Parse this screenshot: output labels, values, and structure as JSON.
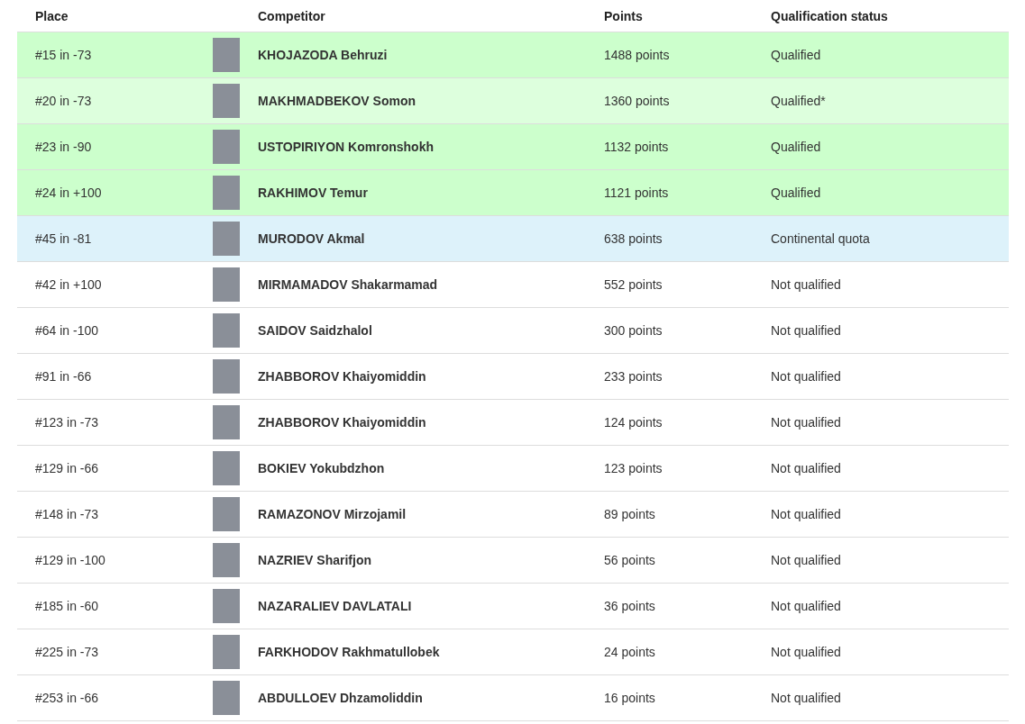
{
  "table": {
    "columns": [
      "Place",
      "Competitor",
      "Points",
      "Qualification status"
    ],
    "rows": [
      {
        "place": "#15 in -73",
        "competitor": "KHOJAZODA Behruzi",
        "points": "1488 points",
        "status": "Qualified",
        "color": "#ccffcc"
      },
      {
        "place": "#20 in -73",
        "competitor": "MAKHMADBEKOV Somon",
        "points": "1360 points",
        "status": "Qualified*",
        "color": "#ddffdd"
      },
      {
        "place": "#23 in -90",
        "competitor": "USTOPIRIYON Komronshokh",
        "points": "1132 points",
        "status": "Qualified",
        "color": "#ccffcc"
      },
      {
        "place": "#24 in +100",
        "competitor": "RAKHIMOV Temur",
        "points": "1121 points",
        "status": "Qualified",
        "color": "#ccffcc"
      },
      {
        "place": "#45 in -81",
        "competitor": "MURODOV Akmal",
        "points": "638 points",
        "status": "Continental quota",
        "color": "#ddf2fa"
      },
      {
        "place": "#42 in +100",
        "competitor": "MIRMAMADOV Shakarmamad",
        "points": "552 points",
        "status": "Not qualified",
        "color": "#ffffff"
      },
      {
        "place": "#64 in -100",
        "competitor": "SAIDOV Saidzhalol",
        "points": "300 points",
        "status": "Not qualified",
        "color": "#ffffff"
      },
      {
        "place": "#91 in -66",
        "competitor": "ZHABBOROV Khaiyomiddin",
        "points": "233 points",
        "status": "Not qualified",
        "color": "#ffffff"
      },
      {
        "place": "#123 in -73",
        "competitor": "ZHABBOROV Khaiyomiddin",
        "points": "124 points",
        "status": "Not qualified",
        "color": "#ffffff"
      },
      {
        "place": "#129 in -66",
        "competitor": "BOKIEV Yokubdzhon",
        "points": "123 points",
        "status": "Not qualified",
        "color": "#ffffff"
      },
      {
        "place": "#148 in -73",
        "competitor": "RAMAZONOV Mirzojamil",
        "points": "89 points",
        "status": "Not qualified",
        "color": "#ffffff"
      },
      {
        "place": "#129 in -100",
        "competitor": "NAZRIEV Sharifjon",
        "points": "56 points",
        "status": "Not qualified",
        "color": "#ffffff"
      },
      {
        "place": "#185 in -60",
        "competitor": "NAZARALIEV DAVLATALI",
        "points": "36 points",
        "status": "Not qualified",
        "color": "#ffffff"
      },
      {
        "place": "#225 in -73",
        "competitor": "FARKHODOV Rakhmatullobek",
        "points": "24 points",
        "status": "Not qualified",
        "color": "#ffffff"
      },
      {
        "place": "#253 in -66",
        "competitor": "ABDULLOEV Dhzamoliddin",
        "points": "16 points",
        "status": "Not qualified",
        "color": "#ffffff"
      }
    ]
  }
}
